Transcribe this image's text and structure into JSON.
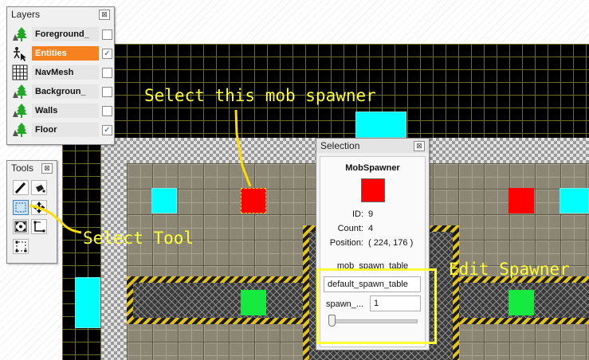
{
  "layers_panel": {
    "title": "Layers",
    "close_glyph": "⊠",
    "layers": [
      {
        "name": "Foreground_",
        "icon": "tree-layer-icon",
        "visible": false,
        "active": false
      },
      {
        "name": "Entities",
        "icon": "entity-layer-icon",
        "visible": true,
        "active": true
      },
      {
        "name": "NavMesh",
        "icon": "grid-layer-icon",
        "visible": false,
        "active": false
      },
      {
        "name": "Backgroun_",
        "icon": "tree-layer-icon",
        "visible": false,
        "active": false
      },
      {
        "name": "Walls",
        "icon": "tree-layer-icon",
        "visible": false,
        "active": false
      },
      {
        "name": "Floor",
        "icon": "tree-layer-icon",
        "visible": true,
        "active": false
      }
    ]
  },
  "tools_panel": {
    "title": "Tools",
    "close_glyph": "⊠",
    "tools": [
      "pencil-tool-icon",
      "bucket-fill-tool-icon",
      "select-tool-icon",
      "move-tool-icon",
      "scale-tool-icon",
      "bounds-tool-icon",
      "resize-tool-icon"
    ],
    "selected_tool": "select-tool-icon"
  },
  "selection_panel": {
    "title": "Selection",
    "close_glyph": "⊠",
    "entity_name": "MobSpawner",
    "swatch_color": "#ff0000",
    "id_label": "ID:",
    "id_value": "9",
    "count_label": "Count:",
    "count_value": "4",
    "position_label": "Position:",
    "position_value": "( 224, 176 )",
    "table_label": "mob_spawn_table",
    "table_value": "default_spawn_table",
    "spawn_label": "spawn_...",
    "spawn_value": "1",
    "slider_value": 0
  },
  "annotations": {
    "select_spawner": "Select this mob spawner",
    "select_tool": "Select Tool",
    "edit_spawner": "Edit Spawner",
    "color": "#ffff33"
  },
  "colors": {
    "spawner": "#ff0000",
    "cyan_tile": "#00ffff",
    "green_tile": "#16e93f",
    "active_layer": "#f7811f"
  }
}
